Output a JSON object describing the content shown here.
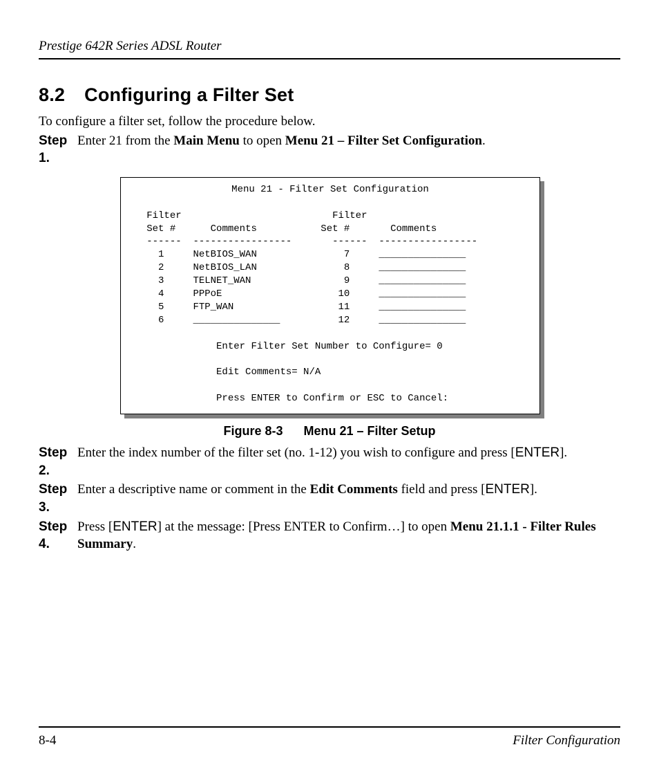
{
  "header": {
    "doc_title": "Prestige 642R Series ADSL Router"
  },
  "section": {
    "number": "8.2",
    "title": "Configuring a Filter Set",
    "intro": "To configure a filter set, follow the procedure below."
  },
  "steps": {
    "s1_label": "Step 1.",
    "s1_pre": "Enter 21 from the ",
    "s1_mm": "Main Menu",
    "s1_mid": " to open ",
    "s1_menu": "Menu 21 – Filter Set Configuration",
    "s1_post": ".",
    "s2_label": "Step 2.",
    "s2_pre": "Enter the index number of the filter set (no. 1-12) you wish to configure and press [",
    "s2_key": "ENTER",
    "s2_post": "].",
    "s3_label": "Step 3.",
    "s3_pre": "Enter a descriptive name or comment in the ",
    "s3_field": "Edit Comments",
    "s3_mid": " field and press [",
    "s3_key": "ENTER",
    "s3_post": "].",
    "s4_label": "Step 4.",
    "s4_pre": "Press [",
    "s4_key": "ENTER",
    "s4_mid": "] at the message: [Press ENTER to Confirm…] to open ",
    "s4_menu": "Menu 21.1.1 - Filter Rules Summary",
    "s4_post": "."
  },
  "menu": {
    "title": "Menu 21 - Filter Set Configuration",
    "hdr_filter": "Filter",
    "hdr_set": "Set #",
    "hdr_comments": "Comments",
    "dash_set": "------",
    "dash_comments": "-----------------",
    "rows_left": [
      {
        "n": "1",
        "c": "NetBIOS_WAN"
      },
      {
        "n": "2",
        "c": "NetBIOS_LAN"
      },
      {
        "n": "3",
        "c": "TELNET_WAN"
      },
      {
        "n": "4",
        "c": "PPPoE"
      },
      {
        "n": "5",
        "c": "FTP_WAN"
      },
      {
        "n": "6",
        "c": "_______________"
      }
    ],
    "rows_right": [
      {
        "n": "7",
        "c": "_______________"
      },
      {
        "n": "8",
        "c": "_______________"
      },
      {
        "n": "9",
        "c": "_______________"
      },
      {
        "n": "10",
        "c": "_______________"
      },
      {
        "n": "11",
        "c": "_______________"
      },
      {
        "n": "12",
        "c": "_______________"
      }
    ],
    "prompt1": "Enter Filter Set Number to Configure= 0",
    "prompt2": "Edit Comments= N/A",
    "prompt3": "Press ENTER to Confirm or ESC to Cancel:"
  },
  "figure": {
    "label": "Figure 8-3",
    "title": "Menu 21 – Filter Setup"
  },
  "footer": {
    "page": "8-4",
    "section": "Filter Configuration"
  }
}
